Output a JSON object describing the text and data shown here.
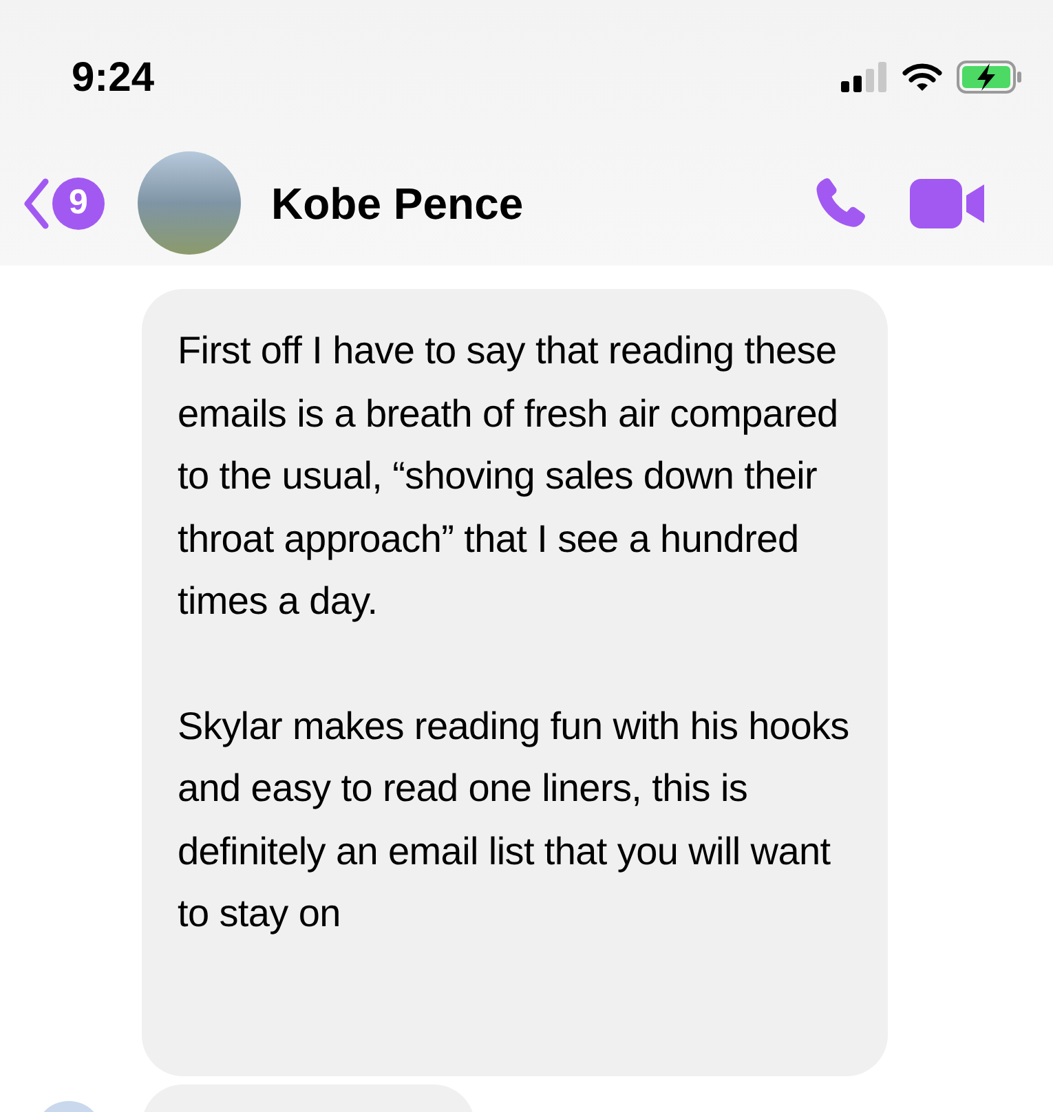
{
  "status_bar": {
    "time": "9:24"
  },
  "header": {
    "back_badge": "9",
    "contact_name": "Kobe Pence"
  },
  "messages": [
    {
      "paragraphs": [
        "First off I have to say that reading these emails is a breath of fresh air compared to the usual, “shoving sales down their throat approach” that I see a hundred times a day.",
        "Skylar makes reading fun with his hooks and easy to read one liners, this is definitely an email list that you will want to stay on"
      ]
    }
  ]
}
